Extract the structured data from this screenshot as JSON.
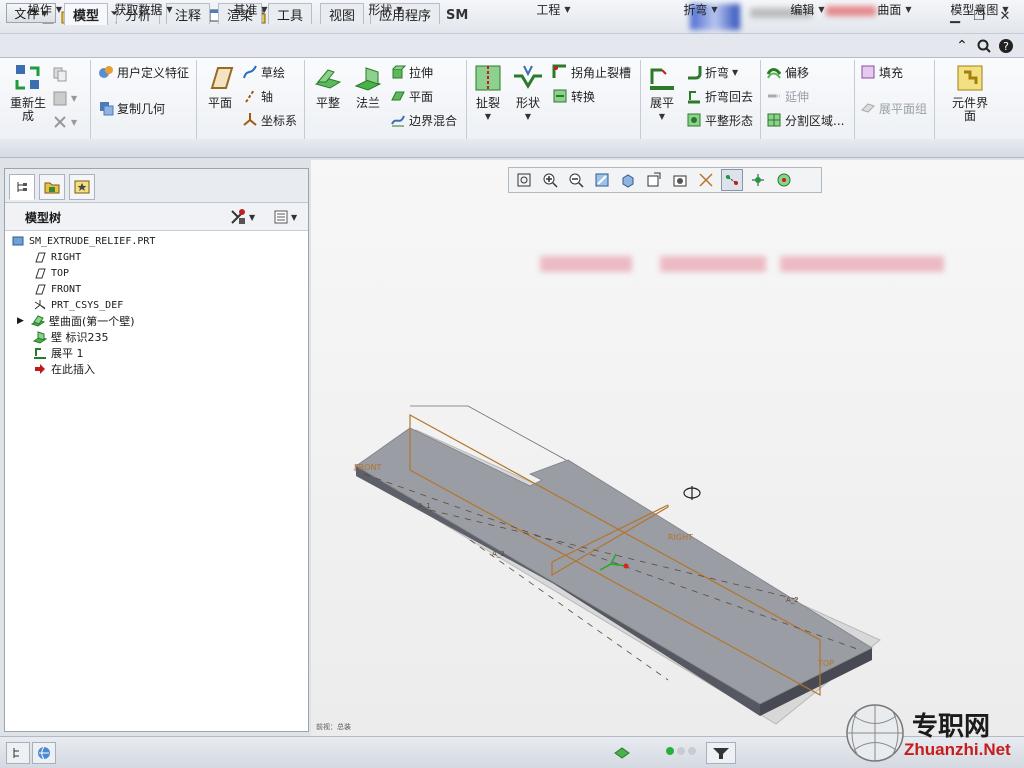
{
  "window": {
    "title": "SM"
  },
  "ribbon": {
    "file_tab": "文件",
    "tabs": [
      "模型",
      "分析",
      "注释",
      "渲染",
      "工具",
      "视图",
      "应用程序"
    ],
    "active_tab": "模型",
    "buttons": {
      "regenerate": "重新生成",
      "user_defined_feature": "用户定义特征",
      "copy_geometry": "复制几何",
      "plane": "平面",
      "sketch": "草绘",
      "axis": "轴",
      "csys": "坐标系",
      "flat": "平整",
      "flange": "法兰",
      "extrude": "拉伸",
      "planar": "平面",
      "boundary_blend": "边界混合",
      "rip": "扯裂",
      "form": "形状",
      "corner_relief": "拐角止裂槽",
      "convert": "转换",
      "unbend": "展平",
      "bend": "折弯",
      "bend_back": "折弯回去",
      "flatten_form": "平整形态",
      "offset": "偏移",
      "extend": "延伸",
      "split_area": "分割区域...",
      "fill": "填充",
      "flat_pattern": "展平面组",
      "component_interface": "元件界面"
    },
    "groups": [
      "操作",
      "获取数据",
      "基准",
      "形状",
      "工程",
      "折弯",
      "编辑",
      "曲面",
      "模型意图"
    ]
  },
  "model_tree": {
    "title": "模型树",
    "items": [
      {
        "label": "SM_EXTRUDE_RELIEF.PRT",
        "icon": "part-icon"
      },
      {
        "label": "RIGHT",
        "icon": "datum-plane-icon"
      },
      {
        "label": "TOP",
        "icon": "datum-plane-icon"
      },
      {
        "label": "FRONT",
        "icon": "datum-plane-icon"
      },
      {
        "label": "PRT_CSYS_DEF",
        "icon": "csys-icon"
      },
      {
        "label": "壁曲面(第一个壁)",
        "icon": "wall-surface-icon"
      },
      {
        "label": "壁 标识235",
        "icon": "wall-icon"
      },
      {
        "label": "展平 1",
        "icon": "unbend-icon"
      },
      {
        "label": "在此插入",
        "icon": "insert-arrow-icon"
      }
    ]
  },
  "viewport": {
    "datum_labels": {
      "front": "FRONT",
      "right": "RIGHT",
      "top": "TOP",
      "a1": "A_1",
      "a2": "A_2",
      "a3": "A_3"
    },
    "coord_label": "前视：总装"
  },
  "watermark": {
    "cn": "专职网",
    "en": "Zhuanzhi.Net"
  },
  "colors": {
    "ribbon_bg": "#eef1f5",
    "datum_orange": "#b5742a",
    "part_top": "#9a9da3",
    "part_side": "#5d6068",
    "watermark_red": "#c81c1c"
  }
}
